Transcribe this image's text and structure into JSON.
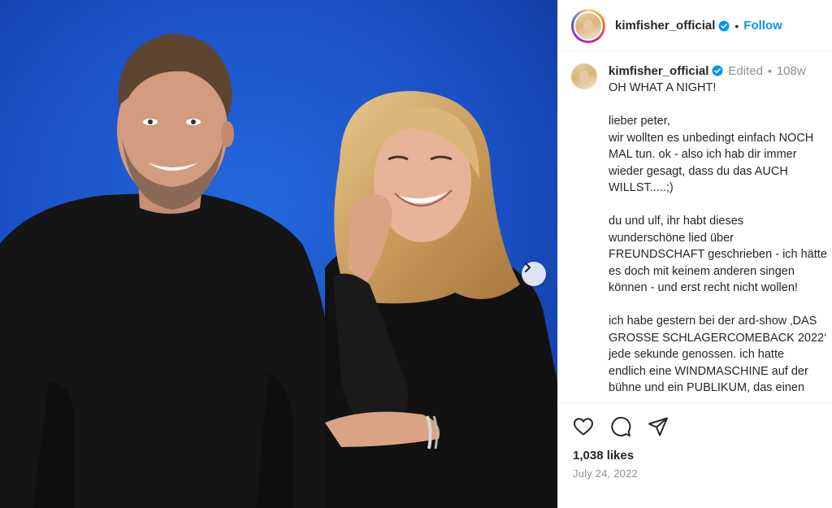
{
  "post": {
    "username": "kimfisher_official",
    "follow_label": "Follow",
    "dot": "•",
    "edited_label": "Edited",
    "age": "108w",
    "caption": "OH WHAT A NIGHT!\n\nlieber peter,\nwir wollten es unbedingt einfach NOCH\nMAL tun. ok - also ich hab dir immer\nwieder gesagt, dass du das AUCH\nWILLST.....;)\n\ndu und ulf, ihr habt dieses\nwunderschöne lied über\nFREUNDSCHAFT geschrieben - ich hätte\nes doch mit keinem anderen singen\nkönnen - und erst recht nicht wollen!\n\nich habe gestern bei der ard-show ‚DAS\nGROSSE SCHLAGERCOMEBACK 2022‘\njede sekunde genossen. ich hatte\nendlich eine WINDMASCHINE auf der\nbühne und ein PUBLIKUM, das einen",
    "likes": "1,038 likes",
    "date": "July 24, 2022"
  },
  "icons": {
    "verified": "verified-badge-icon",
    "like": "heart-icon",
    "comment": "comment-icon",
    "share": "share-icon",
    "next": "chevron-right-icon"
  },
  "colors": {
    "accent": "#0095f6",
    "background_blue": "#1a4fc4",
    "muted_text": "#8e8e8e"
  }
}
